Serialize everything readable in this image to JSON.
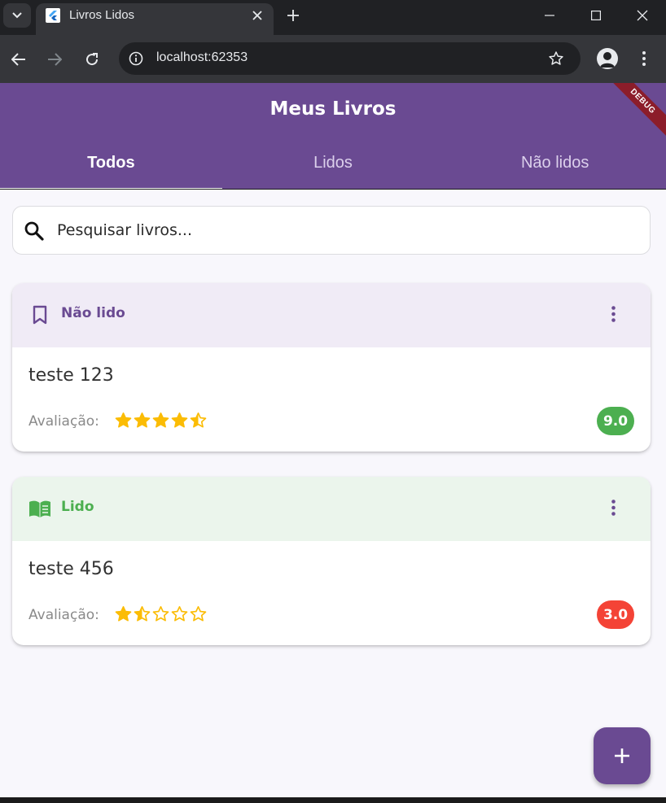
{
  "browser": {
    "tab_title": "Livros Lidos",
    "url": "localhost:62353"
  },
  "app": {
    "title": "Meus Livros",
    "debug_banner": "DEBUG",
    "tabs": [
      {
        "label": "Todos",
        "active": true
      },
      {
        "label": "Lidos",
        "active": false
      },
      {
        "label": "Não lidos",
        "active": false
      }
    ],
    "search_placeholder": "Pesquisar livros...",
    "books": [
      {
        "status": "Não lido",
        "status_icon": "bookmark-icon",
        "status_color": "#6a4a92",
        "header_bg": "#f0ebf6",
        "title": "teste 123",
        "rating_label": "Avaliação:",
        "stars": 4.5,
        "score": "9.0",
        "score_color": "#4caf50"
      },
      {
        "status": "Lido",
        "status_icon": "open-book-icon",
        "status_color": "#4caf50",
        "header_bg": "#ebf5ec",
        "title": "teste 456",
        "rating_label": "Avaliação:",
        "stars": 1.5,
        "score": "3.0",
        "score_color": "#f44336"
      }
    ]
  },
  "colors": {
    "primary": "#6a4a92",
    "star": "#fbbc05"
  }
}
